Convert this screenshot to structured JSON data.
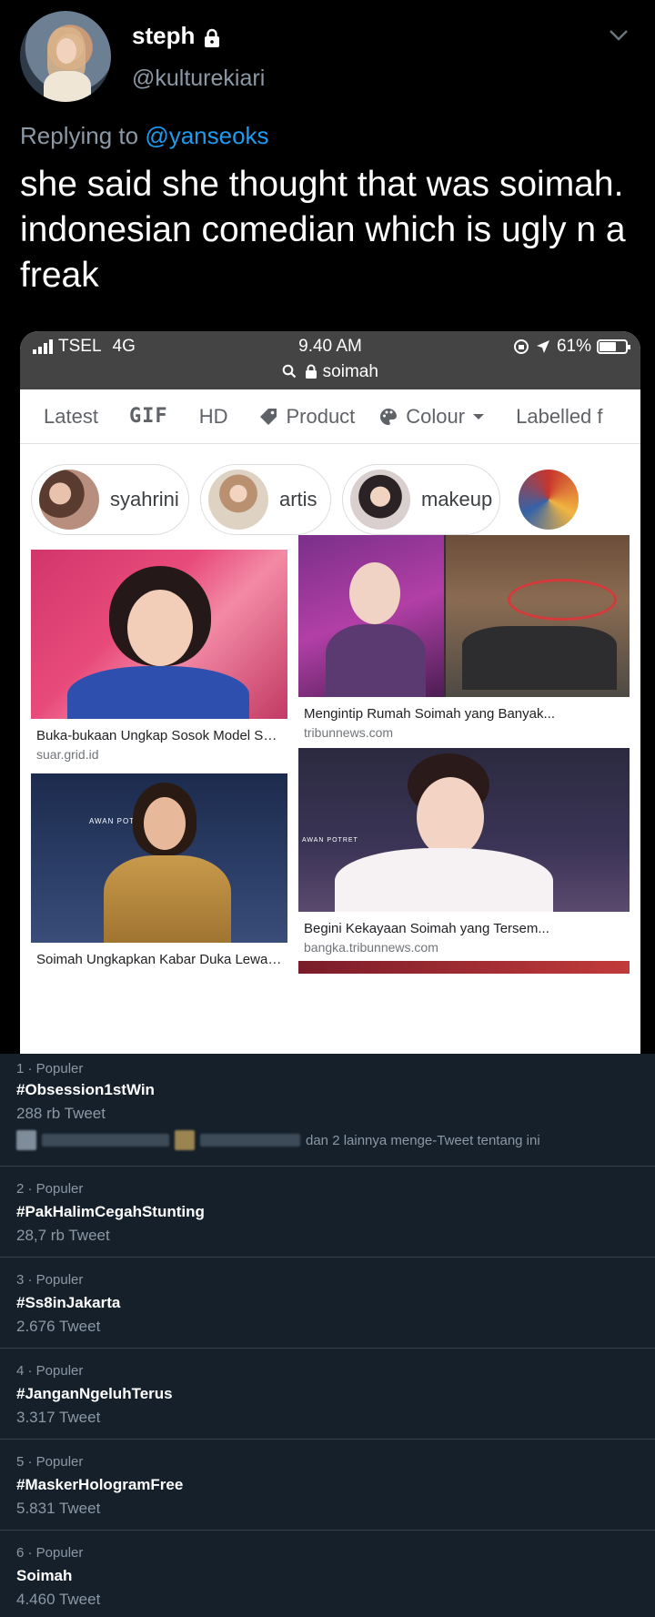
{
  "tweet": {
    "display_name": "steph",
    "handle": "@kulturekiari",
    "replying_prefix": "Replying to ",
    "replying_to": "@yanseoks",
    "text": "she said she thought that was soimah. indonesian comedian which is ugly n a freak"
  },
  "phone": {
    "carrier": "TSEL",
    "network": "4G",
    "time": "9.40 AM",
    "battery": "61%",
    "url": "soimah",
    "filters": [
      {
        "label": "Latest"
      },
      {
        "label": "GIF"
      },
      {
        "label": "HD"
      },
      {
        "label": "Product"
      },
      {
        "label": "Colour"
      },
      {
        "label": "Labelled f"
      }
    ],
    "chips": [
      {
        "label": "syahrini"
      },
      {
        "label": "artis"
      },
      {
        "label": "makeup"
      }
    ],
    "results": [
      {
        "caption": "Buka-bukaan Ungkap Sosok Model Sek...",
        "source": "suar.grid.id"
      },
      {
        "caption": "Mengintip Rumah Soimah yang Banyak...",
        "source": "tribunnews.com"
      },
      {
        "caption": "Soimah Ungkapkan Kabar Duka Lewat ...",
        "source": ""
      },
      {
        "caption": "Begini Kekayaan Soimah yang Tersem...",
        "source": "bangka.tribunnews.com"
      }
    ],
    "overlay_text": [
      "AWAN POTRET",
      "AWAN POTRET"
    ]
  },
  "trends": [
    {
      "rank_meta": "1 · Populer",
      "tag": "#Obsession1stWin",
      "count": "288 rb Tweet",
      "who": "dan 2 lainnya menge-Tweet tentang ini"
    },
    {
      "rank_meta": "2 · Populer",
      "tag": "#PakHalimCegahStunting",
      "count": "28,7 rb Tweet"
    },
    {
      "rank_meta": "3 · Populer",
      "tag": "#Ss8inJakarta",
      "count": "2.676 Tweet"
    },
    {
      "rank_meta": "4 · Populer",
      "tag": "#JanganNgeluhTerus",
      "count": "3.317 Tweet"
    },
    {
      "rank_meta": "5 · Populer",
      "tag": "#MaskerHologramFree",
      "count": "5.831 Tweet"
    },
    {
      "rank_meta": "6 · Populer",
      "tag": "Soimah",
      "count": "4.460 Tweet"
    }
  ],
  "colors": {
    "tweet_bg": "#000000",
    "link": "#1d9bf0",
    "trends_bg": "#15202b",
    "muted": "#8b98a5"
  },
  "icons": [
    "lock-icon",
    "chevron-down-icon",
    "search-icon",
    "signal-icon",
    "battery-icon",
    "tag-icon",
    "palette-icon",
    "location-arrow-icon",
    "rotation-lock-icon"
  ]
}
